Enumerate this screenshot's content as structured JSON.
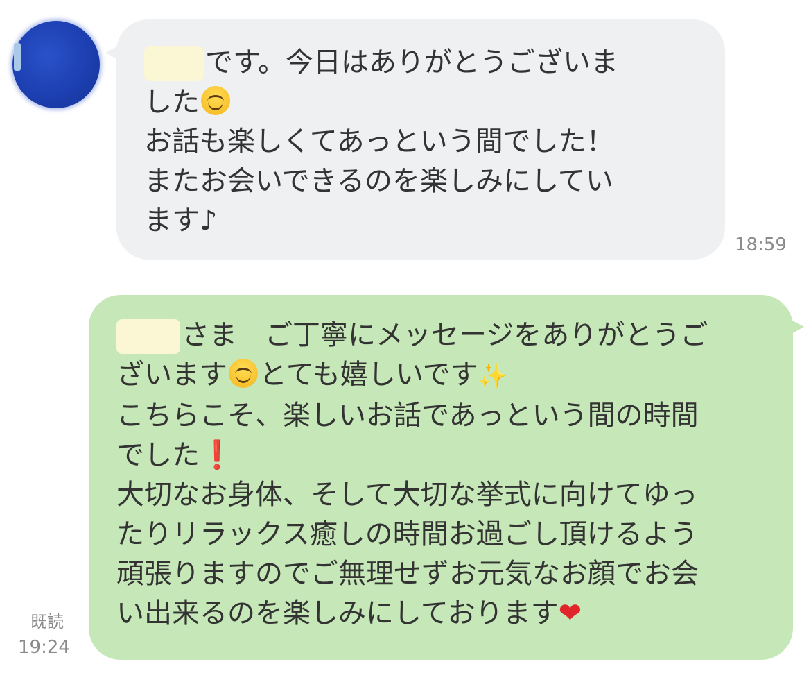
{
  "incoming": {
    "sender_avatar": "avatar-blurred",
    "name_redacted": "■■",
    "lines": [
      "です。今日はありがとうございま",
      "した",
      "お話も楽しくてあっという間でした！",
      "またお会いできるのを楽しみにしてい",
      "ます♪"
    ],
    "time": "18:59"
  },
  "outgoing": {
    "lines": [
      "さま　ご丁寧にメッセージをありがとうご",
      "ざいます",
      "とても嬉しいです",
      "こちらこそ、楽しいお話であっという間の時間",
      "でした",
      "大切なお身体、そして大切な挙式に向けてゆっ",
      "たりリラックス癒しの時間お過ごし頂けるよう",
      "頑張りますのでご無理せずお元気なお顔でお会",
      "い出来るのを楽しみにしております"
    ],
    "read_label": "既読",
    "time": "19:24"
  },
  "icons": {
    "smile": "smiling-face-emoji",
    "sparkles": "✨",
    "exclamation": "❗",
    "heart": "❤"
  },
  "colors": {
    "incoming_bubble": "#eff0f2",
    "outgoing_bubble": "#c6e7b7",
    "meta_text": "#8a8a8a"
  }
}
